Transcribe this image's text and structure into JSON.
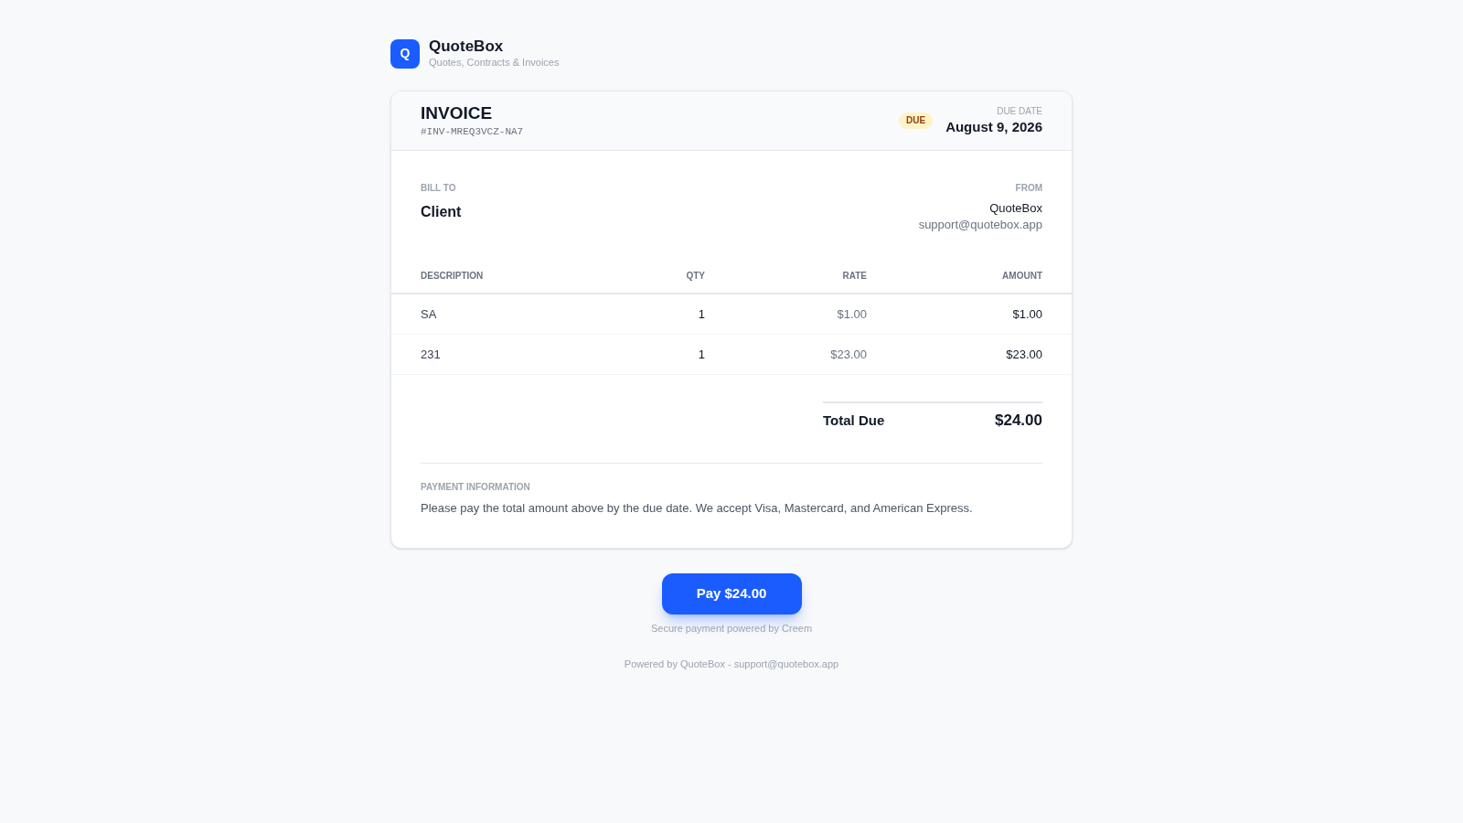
{
  "brand": {
    "logo_letter": "Q",
    "name": "QuoteBox",
    "tagline": "Quotes, Contracts & Invoices"
  },
  "invoice": {
    "title": "INVOICE",
    "number": "#INV-MREQ3VCZ-NA7",
    "status": {
      "label": "DUE",
      "kind": "due"
    },
    "due_date_label": "DUE DATE",
    "due_date": "August 9, 2026"
  },
  "bill_to": {
    "label": "BILL TO",
    "name": "Client"
  },
  "from": {
    "label": "FROM",
    "name": "QuoteBox",
    "email": "support@quotebox.app"
  },
  "table": {
    "columns": [
      "DESCRIPTION",
      "QTY",
      "RATE",
      "AMOUNT"
    ],
    "rows": [
      [
        "SA",
        "1",
        "$1.00",
        "$1.00"
      ],
      [
        "231",
        "1",
        "$23.00",
        "$23.00"
      ]
    ]
  },
  "total": {
    "label": "Total Due",
    "value": "$24.00"
  },
  "payment_info": {
    "label": "PAYMENT INFORMATION",
    "text": "Please pay the total amount above by the due date. We accept Visa, Mastercard, and American Express."
  },
  "pay_button": "Pay $24.00",
  "secure_note": "Secure payment powered by Creem",
  "footer": "Powered by QuoteBox - support@quotebox.app"
}
